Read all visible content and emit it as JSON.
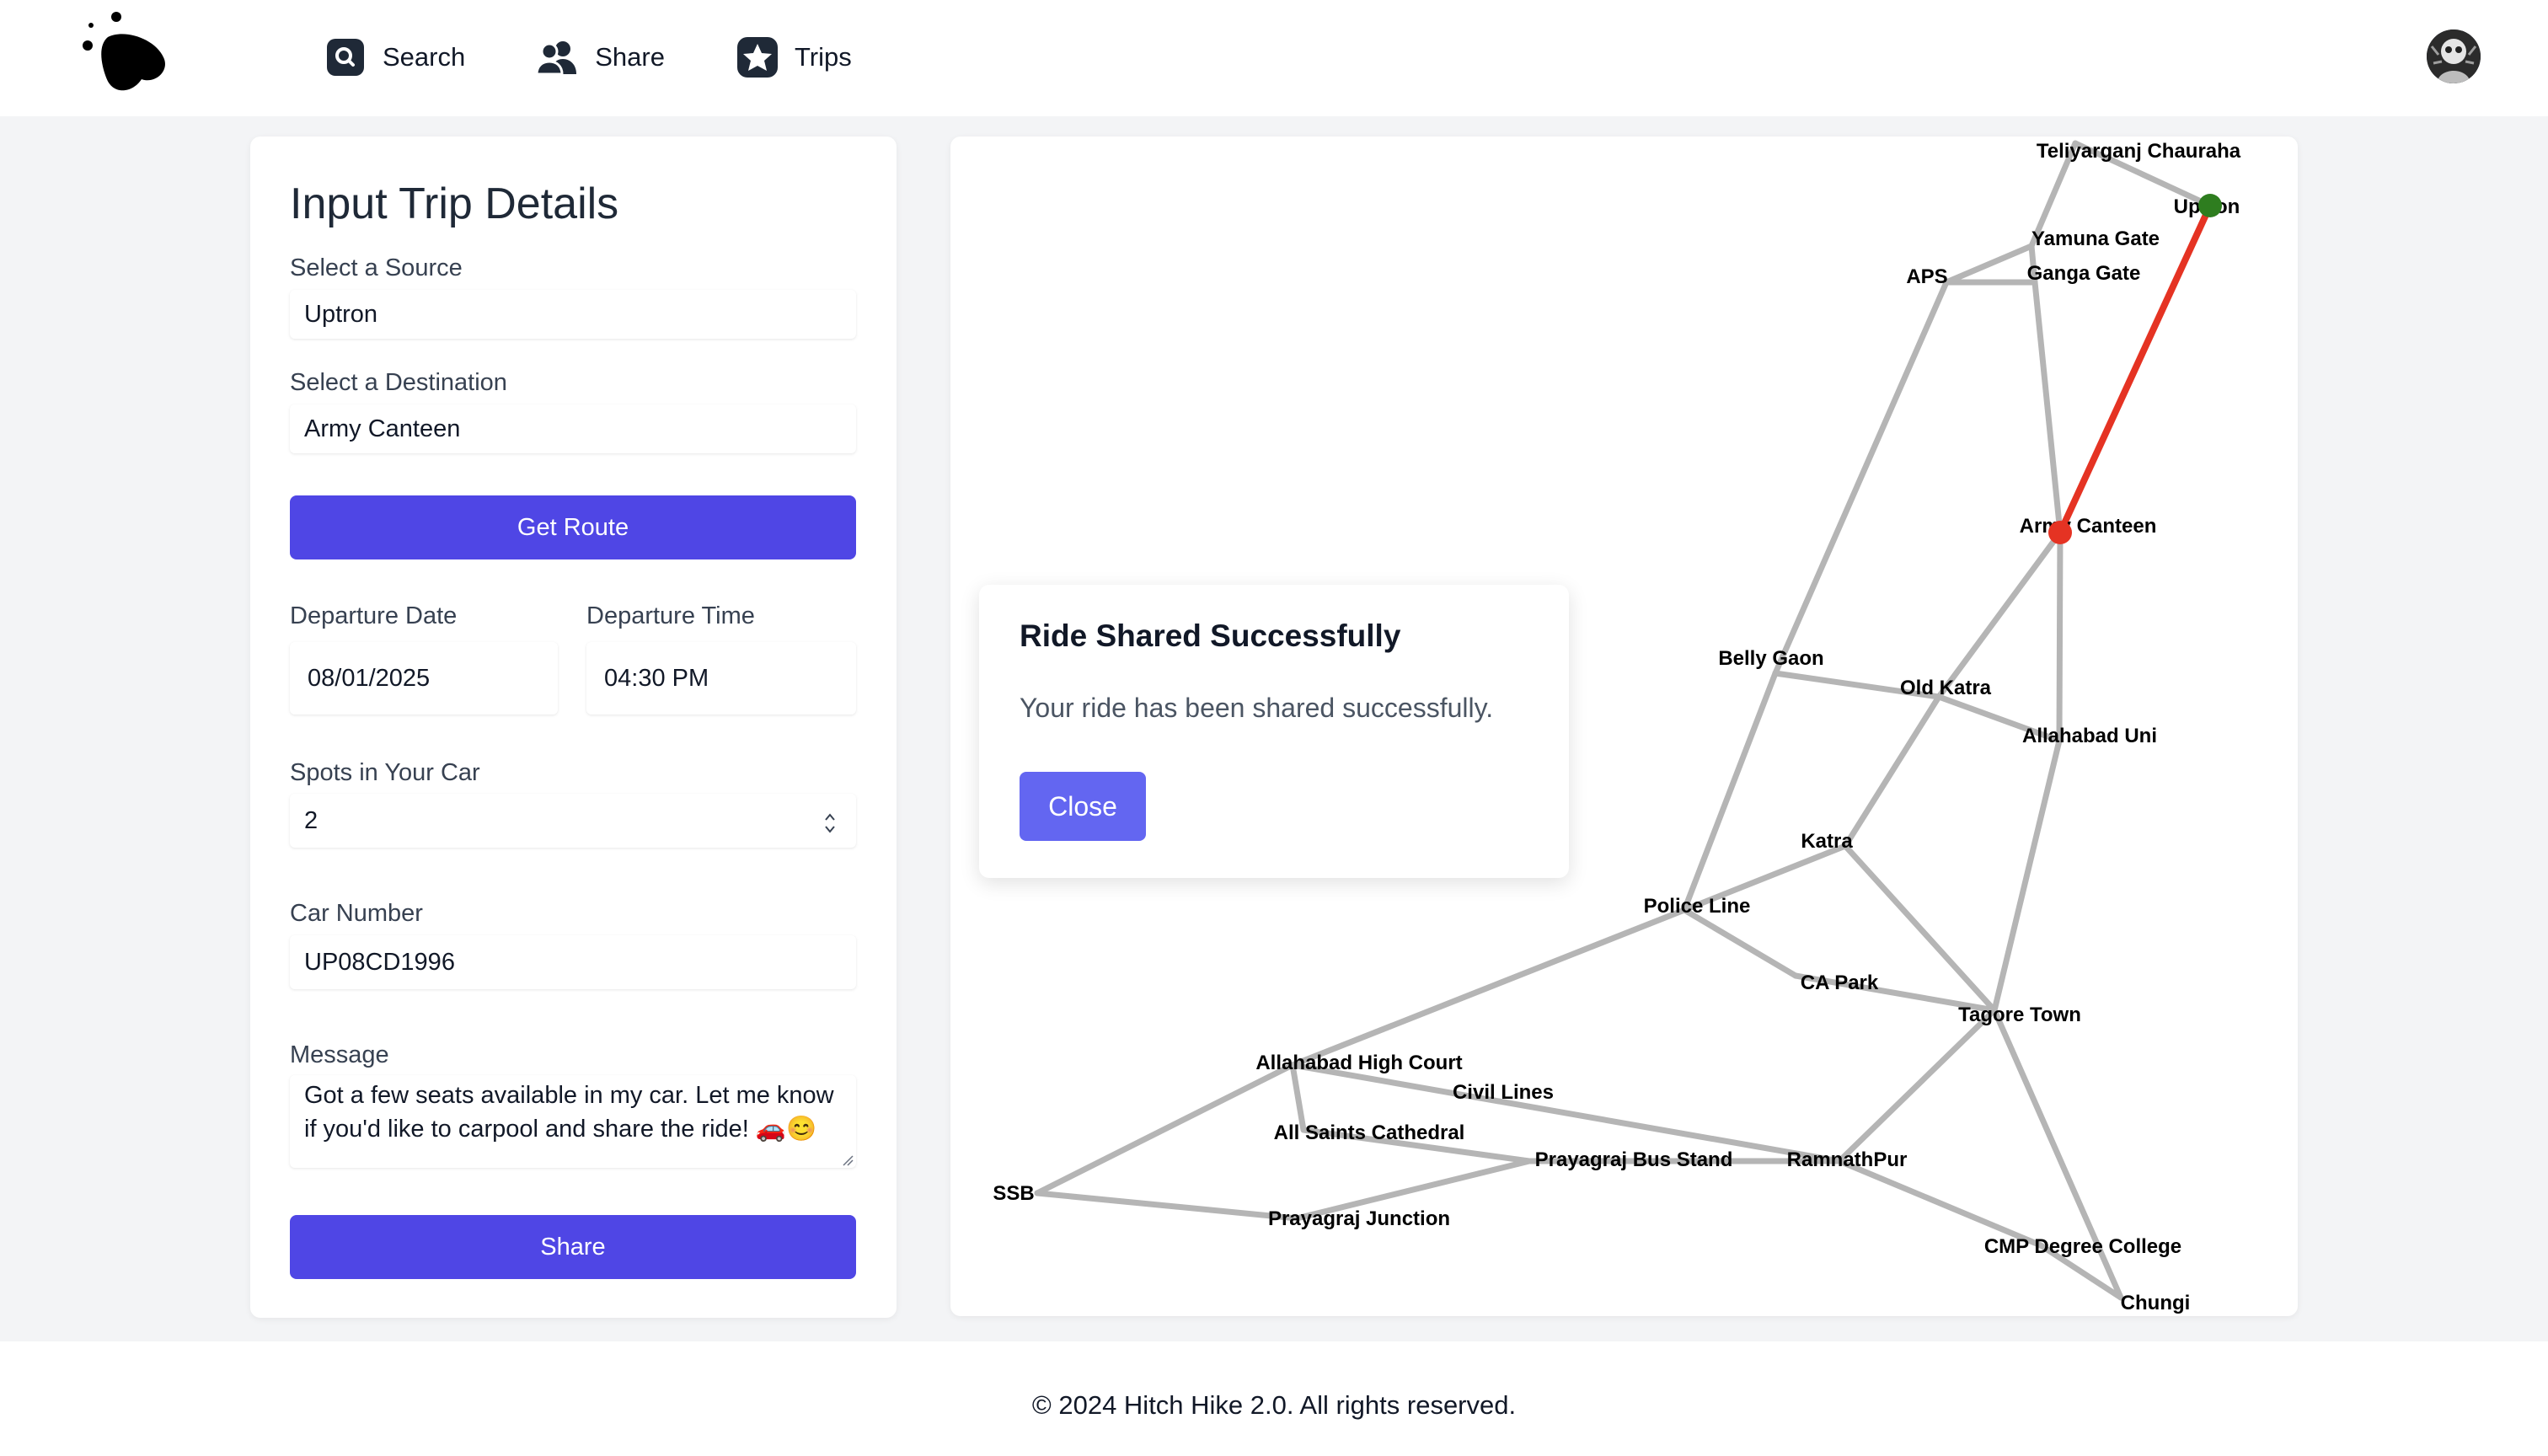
{
  "nav": {
    "items": [
      {
        "label": "Search",
        "icon": "search-icon"
      },
      {
        "label": "Share",
        "icon": "users-icon"
      },
      {
        "label": "Trips",
        "icon": "star-icon"
      }
    ]
  },
  "form": {
    "title": "Input Trip Details",
    "source_label": "Select a Source",
    "source_value": "Uptron",
    "destination_label": "Select a Destination",
    "destination_value": "Army Canteen",
    "get_route_label": "Get Route",
    "departure_date_label": "Departure Date",
    "departure_date_value": "08/01/2025",
    "departure_time_label": "Departure Time",
    "departure_time_value": "04:30 PM",
    "spots_label": "Spots in Your Car",
    "spots_value": "2",
    "car_number_label": "Car Number",
    "car_number_value": "UP08CD1996",
    "message_label": "Message",
    "message_value": "Got a few seats available in my car. Let me know if you'd like to carpool and share the ride! 🚗😊",
    "share_label": "Share"
  },
  "modal": {
    "title": "Ride Shared Successfully",
    "text": "Your ride has been shared successfully.",
    "close_label": "Close"
  },
  "map": {
    "edge_color": "#b5b5b5",
    "route_color": "#e53323",
    "source_color": "#2e7d1f",
    "destination_color": "#e53323",
    "source": "Uptron",
    "destination": "Army Canteen",
    "nodes": [
      "Teliyarganj Chauraha",
      "Uptron",
      "Yamuna Gate",
      "Ganga Gate",
      "APS",
      "Army Canteen",
      "Belly Gaon",
      "Old Katra",
      "Allahabad Uni",
      "Katra",
      "Police Line",
      "CA Park",
      "Tagore Town",
      "Allahabad High Court",
      "Civil Lines",
      "All Saints Cathedral",
      "Prayagraj Bus Stand",
      "RamnathPur",
      "SSB",
      "Prayagraj Junction",
      "CMP Degree College",
      "Chungi"
    ]
  },
  "footer": {
    "text": "© 2024 Hitch Hike 2.0. All rights reserved."
  }
}
